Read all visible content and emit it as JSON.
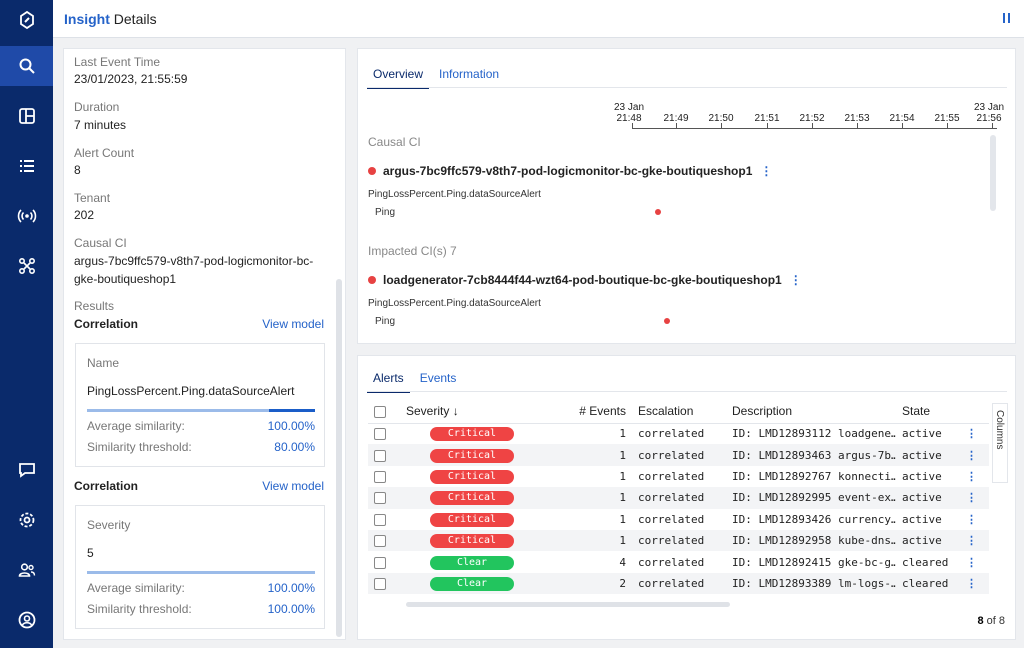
{
  "header": {
    "title_a": "Insight",
    "title_b": " Details"
  },
  "details": {
    "last_event_time_label": "Last Event Time",
    "last_event_time": "23/01/2023, 21:55:59",
    "duration_label": "Duration",
    "duration": "7 minutes",
    "alert_count_label": "Alert Count",
    "alert_count": "8",
    "tenant_label": "Tenant",
    "tenant": "202",
    "causal_ci_label": "Causal CI",
    "causal_ci": "argus-7bc9ffc579-v8th7-pod-logicmonitor-bc-gke-boutiqueshop1",
    "results_label": "Results"
  },
  "correlations": [
    {
      "title": "Correlation",
      "view_model": "View model",
      "name_label": "Name",
      "name_value": "PingLossPercent.Ping.dataSourceAlert",
      "avg_label": "Average similarity:",
      "avg_value": "100.00%",
      "thr_label": "Similarity threshold:",
      "thr_value": "80.00%",
      "threshold_fraction": 0.8
    },
    {
      "title": "Correlation",
      "view_model": "View model",
      "name_label": "Severity",
      "name_value": "5",
      "avg_label": "Average similarity:",
      "avg_value": "100.00%",
      "thr_label": "Similarity threshold:",
      "thr_value": "100.00%",
      "threshold_fraction": 1.0
    }
  ],
  "overview": {
    "tabs": [
      "Overview",
      "Information"
    ],
    "timeline": {
      "start_date": "23 Jan",
      "start_time": "21:48",
      "end_date": "23 Jan",
      "end_time": "21:56",
      "ticks": [
        "21:49",
        "21:50",
        "21:51",
        "21:52",
        "21:53",
        "21:54",
        "21:55"
      ]
    },
    "causal_label": "Causal CI",
    "causal_ci": "argus-7bc9ffc579-v8th7-pod-logicmonitor-bc-gke-boutiqueshop1",
    "causal_datasource": "PingLossPercent.Ping.dataSourceAlert",
    "causal_instance": "Ping",
    "impacted_label": "Impacted CI(s) 7",
    "impacted_ci": "loadgenerator-7cb8444f44-wzt64-pod-boutique-bc-gke-boutiqueshop1",
    "impacted_datasource": "PingLossPercent.Ping.dataSourceAlert",
    "impacted_instance": "Ping",
    "kebab": "⋮"
  },
  "alerts": {
    "tabs": [
      "Alerts",
      "Events"
    ],
    "columns": [
      "Severity",
      "# Events",
      "Escalation",
      "Description",
      "State"
    ],
    "sort_glyph": "↓",
    "columns_button": "Columns",
    "rows": [
      {
        "severity": "Critical",
        "level": "crit",
        "events": "1",
        "escalation": "correlated",
        "description": "ID: LMD12893112 loadgene…",
        "state": "active"
      },
      {
        "severity": "Critical",
        "level": "crit",
        "events": "1",
        "escalation": "correlated",
        "description": "ID: LMD12893463 argus-7b…",
        "state": "active"
      },
      {
        "severity": "Critical",
        "level": "crit",
        "events": "1",
        "escalation": "correlated",
        "description": "ID: LMD12892767 konnecti…",
        "state": "active"
      },
      {
        "severity": "Critical",
        "level": "crit",
        "events": "1",
        "escalation": "correlated",
        "description": "ID: LMD12892995 event-ex…",
        "state": "active"
      },
      {
        "severity": "Critical",
        "level": "crit",
        "events": "1",
        "escalation": "correlated",
        "description": "ID: LMD12893426 currency…",
        "state": "active"
      },
      {
        "severity": "Critical",
        "level": "crit",
        "events": "1",
        "escalation": "correlated",
        "description": "ID: LMD12892958 kube-dns…",
        "state": "active"
      },
      {
        "severity": "Clear",
        "level": "clear",
        "events": "4",
        "escalation": "correlated",
        "description": "ID: LMD12892415 gke-bc-g…",
        "state": "cleared"
      },
      {
        "severity": "Clear",
        "level": "clear",
        "events": "2",
        "escalation": "correlated",
        "description": "ID: LMD12893389 lm-logs-…",
        "state": "cleared"
      }
    ],
    "pager_count": "8",
    "pager_total": " of 8"
  }
}
